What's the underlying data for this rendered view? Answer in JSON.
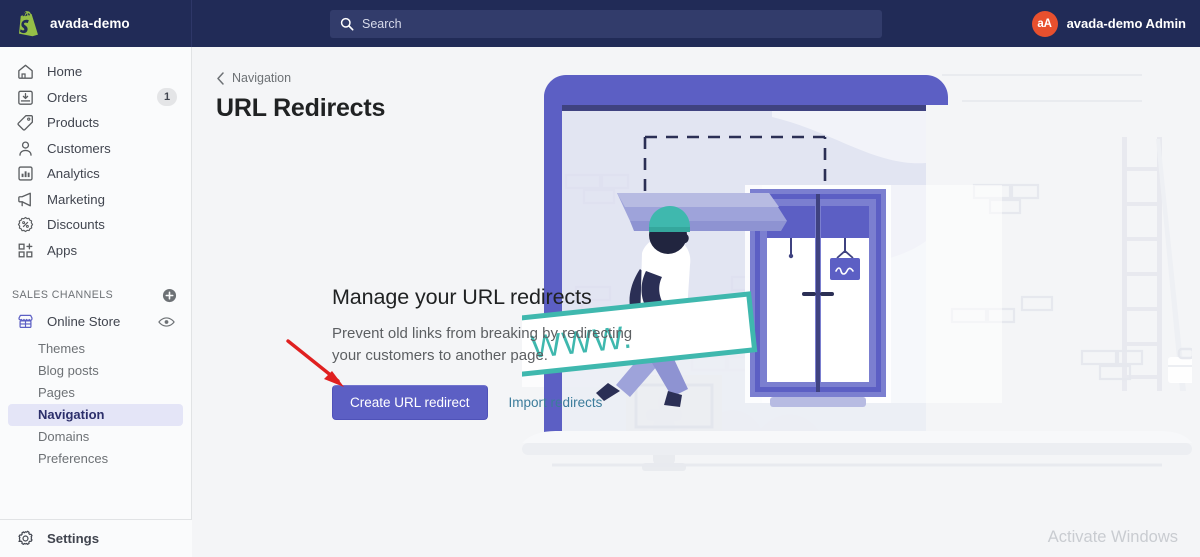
{
  "topbar": {
    "logo_icon": "shopify-bag-icon",
    "store_name": "avada-demo",
    "search": {
      "icon": "search-icon",
      "placeholder": "Search",
      "value": ""
    },
    "user": {
      "avatar_initials": "aA",
      "name": "avada-demo Admin",
      "avatar_color": "#e8502e"
    }
  },
  "sidebar": {
    "items": [
      {
        "label": "Home",
        "icon": "home-icon",
        "badge": ""
      },
      {
        "label": "Orders",
        "icon": "orders-icon",
        "badge": "1"
      },
      {
        "label": "Products",
        "icon": "products-tag-icon",
        "badge": ""
      },
      {
        "label": "Customers",
        "icon": "customers-person-icon",
        "badge": ""
      },
      {
        "label": "Analytics",
        "icon": "analytics-bars-icon",
        "badge": ""
      },
      {
        "label": "Marketing",
        "icon": "marketing-megaphone-icon",
        "badge": ""
      },
      {
        "label": "Discounts",
        "icon": "discounts-percent-icon",
        "badge": ""
      },
      {
        "label": "Apps",
        "icon": "apps-grid-plus-icon",
        "badge": ""
      }
    ],
    "sales_channels": {
      "title": "SALES CHANNELS",
      "add_icon": "plus-circle-icon",
      "channel": {
        "label": "Online Store",
        "icon": "online-store-icon",
        "preview_icon": "eye-icon"
      },
      "subitems": [
        {
          "label": "Themes",
          "active": false
        },
        {
          "label": "Blog posts",
          "active": false
        },
        {
          "label": "Pages",
          "active": false
        },
        {
          "label": "Navigation",
          "active": true
        },
        {
          "label": "Domains",
          "active": false
        },
        {
          "label": "Preferences",
          "active": false
        }
      ]
    },
    "footer": {
      "label": "Settings",
      "icon": "gear-icon"
    }
  },
  "main": {
    "breadcrumb": {
      "icon": "chevron-left-icon",
      "label": "Navigation"
    },
    "page_title": "URL Redirects",
    "empty_state": {
      "heading": "Manage your URL redirects",
      "description": "Prevent old links from breaking by redirecting your customers to another page.",
      "primary_button": "Create URL redirect",
      "secondary_link": "Import redirects",
      "illustration": "url-redirect-storefront-illustration",
      "annotation_icon": "red-arrow-annotation"
    }
  },
  "overlay": {
    "watermark": "Activate Windows"
  },
  "colors": {
    "topbar_bg": "#212b57",
    "search_bg": "#323c6b",
    "sidebar_bg": "#fafbfc",
    "main_bg": "#f4f5f7",
    "primary_button": "#5c5fc4",
    "link": "#3c7c9b",
    "active_nav_bg": "#e4e5f7",
    "active_nav_text": "#2c2f6b",
    "illustration_purple": "#5c5fc4",
    "illustration_teal": "#3fb8ae",
    "annotation_red": "#e02020"
  }
}
